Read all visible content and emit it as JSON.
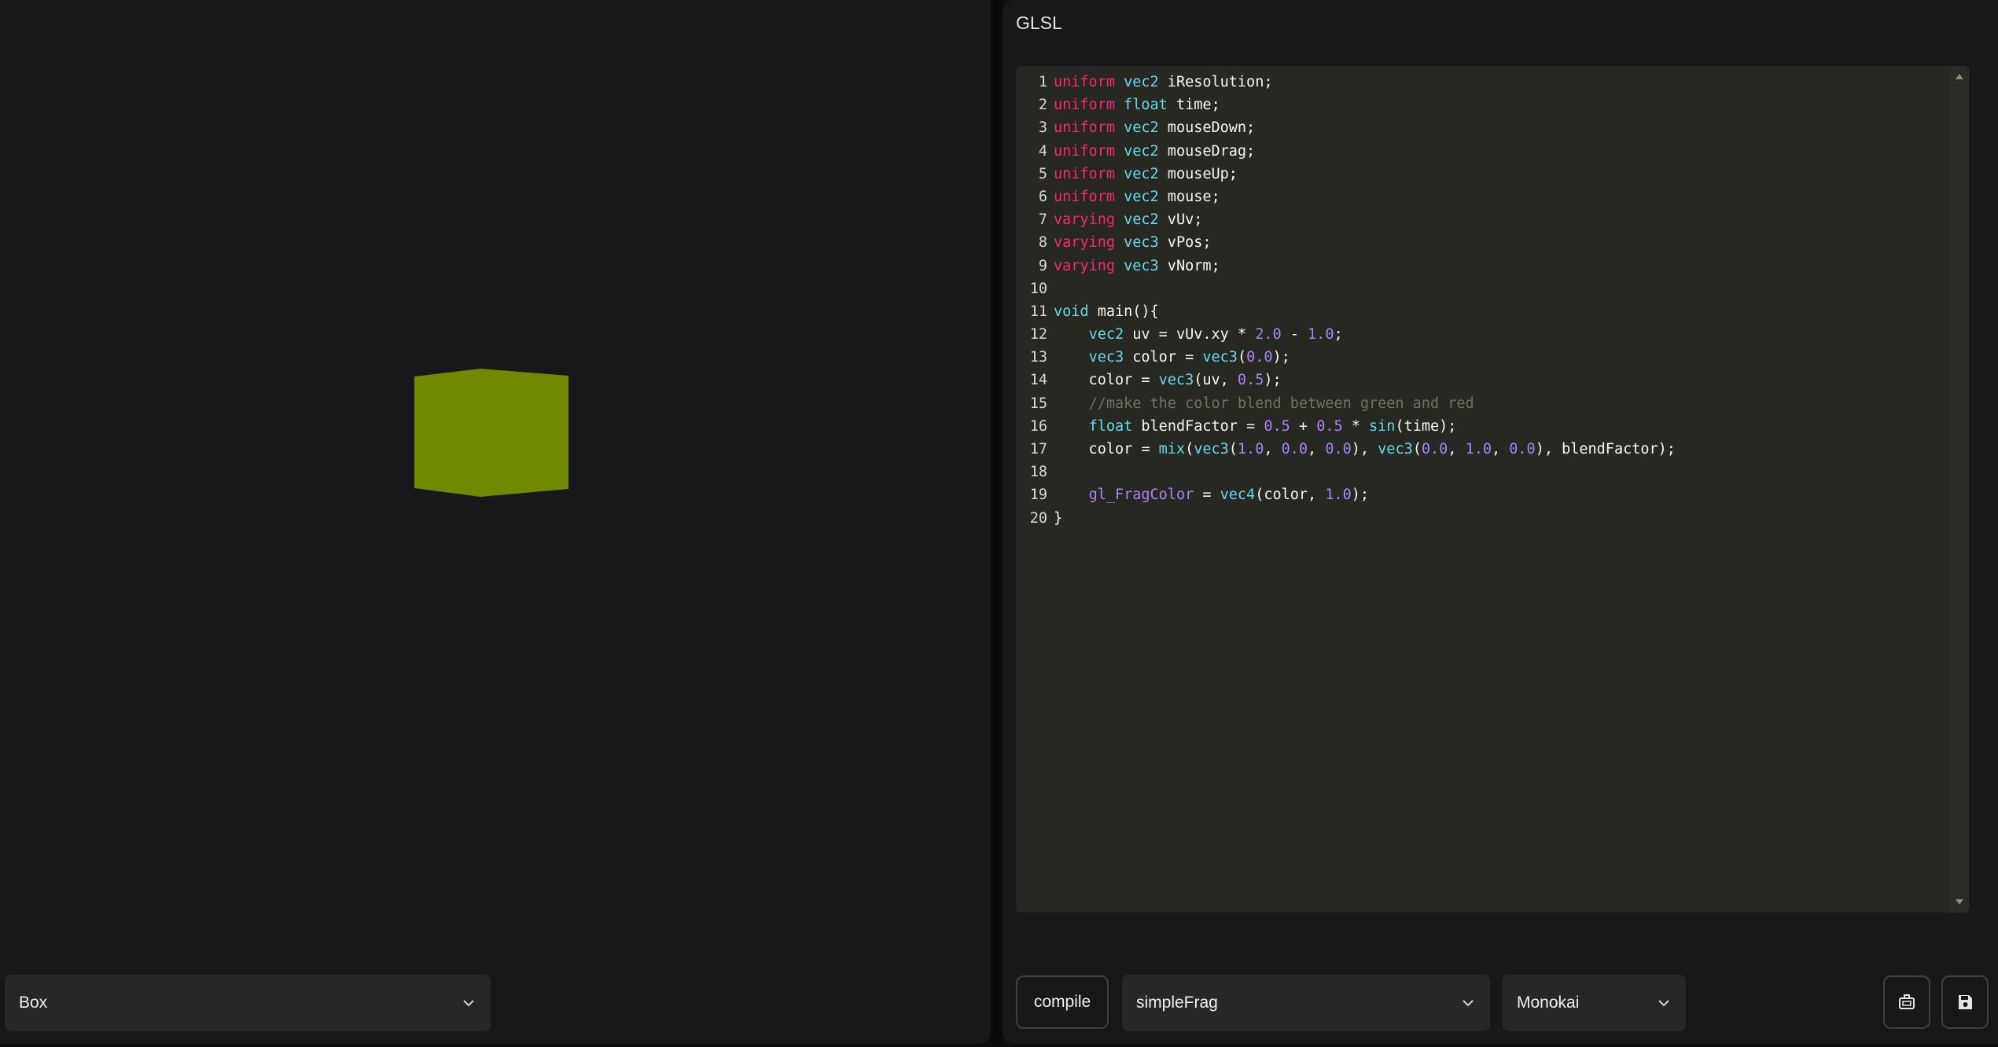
{
  "viewport": {
    "shape_select": {
      "value": "Box"
    }
  },
  "editor": {
    "title": "GLSL",
    "theme": "Monokai",
    "lines": [
      {
        "n": "1",
        "tokens": [
          {
            "t": "uniform",
            "c": "kw"
          },
          {
            "t": " "
          },
          {
            "t": "vec2",
            "c": "type"
          },
          {
            "t": " iResolution;"
          }
        ]
      },
      {
        "n": "2",
        "tokens": [
          {
            "t": "uniform",
            "c": "kw"
          },
          {
            "t": " "
          },
          {
            "t": "float",
            "c": "type"
          },
          {
            "t": " time;"
          }
        ]
      },
      {
        "n": "3",
        "tokens": [
          {
            "t": "uniform",
            "c": "kw"
          },
          {
            "t": " "
          },
          {
            "t": "vec2",
            "c": "type"
          },
          {
            "t": " mouseDown;"
          }
        ]
      },
      {
        "n": "4",
        "tokens": [
          {
            "t": "uniform",
            "c": "kw"
          },
          {
            "t": " "
          },
          {
            "t": "vec2",
            "c": "type"
          },
          {
            "t": " mouseDrag;"
          }
        ]
      },
      {
        "n": "5",
        "tokens": [
          {
            "t": "uniform",
            "c": "kw"
          },
          {
            "t": " "
          },
          {
            "t": "vec2",
            "c": "type"
          },
          {
            "t": " mouseUp;"
          }
        ]
      },
      {
        "n": "6",
        "tokens": [
          {
            "t": "uniform",
            "c": "kw"
          },
          {
            "t": " "
          },
          {
            "t": "vec2",
            "c": "type"
          },
          {
            "t": " mouse;"
          }
        ]
      },
      {
        "n": "7",
        "tokens": [
          {
            "t": "varying",
            "c": "kw"
          },
          {
            "t": " "
          },
          {
            "t": "vec2",
            "c": "type"
          },
          {
            "t": " vUv;"
          }
        ]
      },
      {
        "n": "8",
        "tokens": [
          {
            "t": "varying",
            "c": "kw"
          },
          {
            "t": " "
          },
          {
            "t": "vec3",
            "c": "type"
          },
          {
            "t": " vPos;"
          }
        ]
      },
      {
        "n": "9",
        "tokens": [
          {
            "t": "varying",
            "c": "kw"
          },
          {
            "t": " "
          },
          {
            "t": "vec3",
            "c": "type"
          },
          {
            "t": " vNorm;"
          }
        ]
      },
      {
        "n": "10",
        "tokens": []
      },
      {
        "n": "11",
        "tokens": [
          {
            "t": "void",
            "c": "type"
          },
          {
            "t": " main(){"
          }
        ]
      },
      {
        "n": "12",
        "tokens": [
          {
            "t": "    "
          },
          {
            "t": "vec2",
            "c": "type"
          },
          {
            "t": " uv = vUv.xy * "
          },
          {
            "t": "2.0",
            "c": "num"
          },
          {
            "t": " - "
          },
          {
            "t": "1.0",
            "c": "num"
          },
          {
            "t": ";"
          }
        ]
      },
      {
        "n": "13",
        "tokens": [
          {
            "t": "    "
          },
          {
            "t": "vec3",
            "c": "type"
          },
          {
            "t": " color = "
          },
          {
            "t": "vec3",
            "c": "fn"
          },
          {
            "t": "("
          },
          {
            "t": "0.0",
            "c": "num"
          },
          {
            "t": ");"
          }
        ]
      },
      {
        "n": "14",
        "tokens": [
          {
            "t": "    color = "
          },
          {
            "t": "vec3",
            "c": "fn"
          },
          {
            "t": "(uv, "
          },
          {
            "t": "0.5",
            "c": "num"
          },
          {
            "t": ");"
          }
        ]
      },
      {
        "n": "15",
        "tokens": [
          {
            "t": "    "
          },
          {
            "t": "//make the color blend between green and red",
            "c": "cm"
          }
        ]
      },
      {
        "n": "16",
        "tokens": [
          {
            "t": "    "
          },
          {
            "t": "float",
            "c": "type"
          },
          {
            "t": " blendFactor = "
          },
          {
            "t": "0.5",
            "c": "num"
          },
          {
            "t": " + "
          },
          {
            "t": "0.5",
            "c": "num"
          },
          {
            "t": " * "
          },
          {
            "t": "sin",
            "c": "fn"
          },
          {
            "t": "(time);"
          }
        ]
      },
      {
        "n": "17",
        "tokens": [
          {
            "t": "    color = "
          },
          {
            "t": "mix",
            "c": "fn"
          },
          {
            "t": "("
          },
          {
            "t": "vec3",
            "c": "fn"
          },
          {
            "t": "("
          },
          {
            "t": "1.0",
            "c": "num"
          },
          {
            "t": ", "
          },
          {
            "t": "0.0",
            "c": "num"
          },
          {
            "t": ", "
          },
          {
            "t": "0.0",
            "c": "num"
          },
          {
            "t": "), "
          },
          {
            "t": "vec3",
            "c": "fn"
          },
          {
            "t": "("
          },
          {
            "t": "0.0",
            "c": "num"
          },
          {
            "t": ", "
          },
          {
            "t": "1.0",
            "c": "num"
          },
          {
            "t": ", "
          },
          {
            "t": "0.0",
            "c": "num"
          },
          {
            "t": "), blendFactor);"
          }
        ]
      },
      {
        "n": "18",
        "tokens": []
      },
      {
        "n": "19",
        "tokens": [
          {
            "t": "    "
          },
          {
            "t": "gl_FragColor",
            "c": "bi"
          },
          {
            "t": " = "
          },
          {
            "t": "vec4",
            "c": "fn"
          },
          {
            "t": "(color, "
          },
          {
            "t": "1.0",
            "c": "num"
          },
          {
            "t": ");"
          }
        ]
      },
      {
        "n": "20",
        "tokens": [
          {
            "t": "}"
          }
        ]
      }
    ]
  },
  "toolbar": {
    "compile_label": "compile",
    "shader_select": "simpleFrag",
    "theme_select": "Monokai",
    "icons": {
      "screenshot": "camera-icon",
      "save": "save-icon"
    }
  },
  "colors": {
    "cube_front": "#708a00",
    "background": "#18181b",
    "editor_bg": "#272822"
  }
}
